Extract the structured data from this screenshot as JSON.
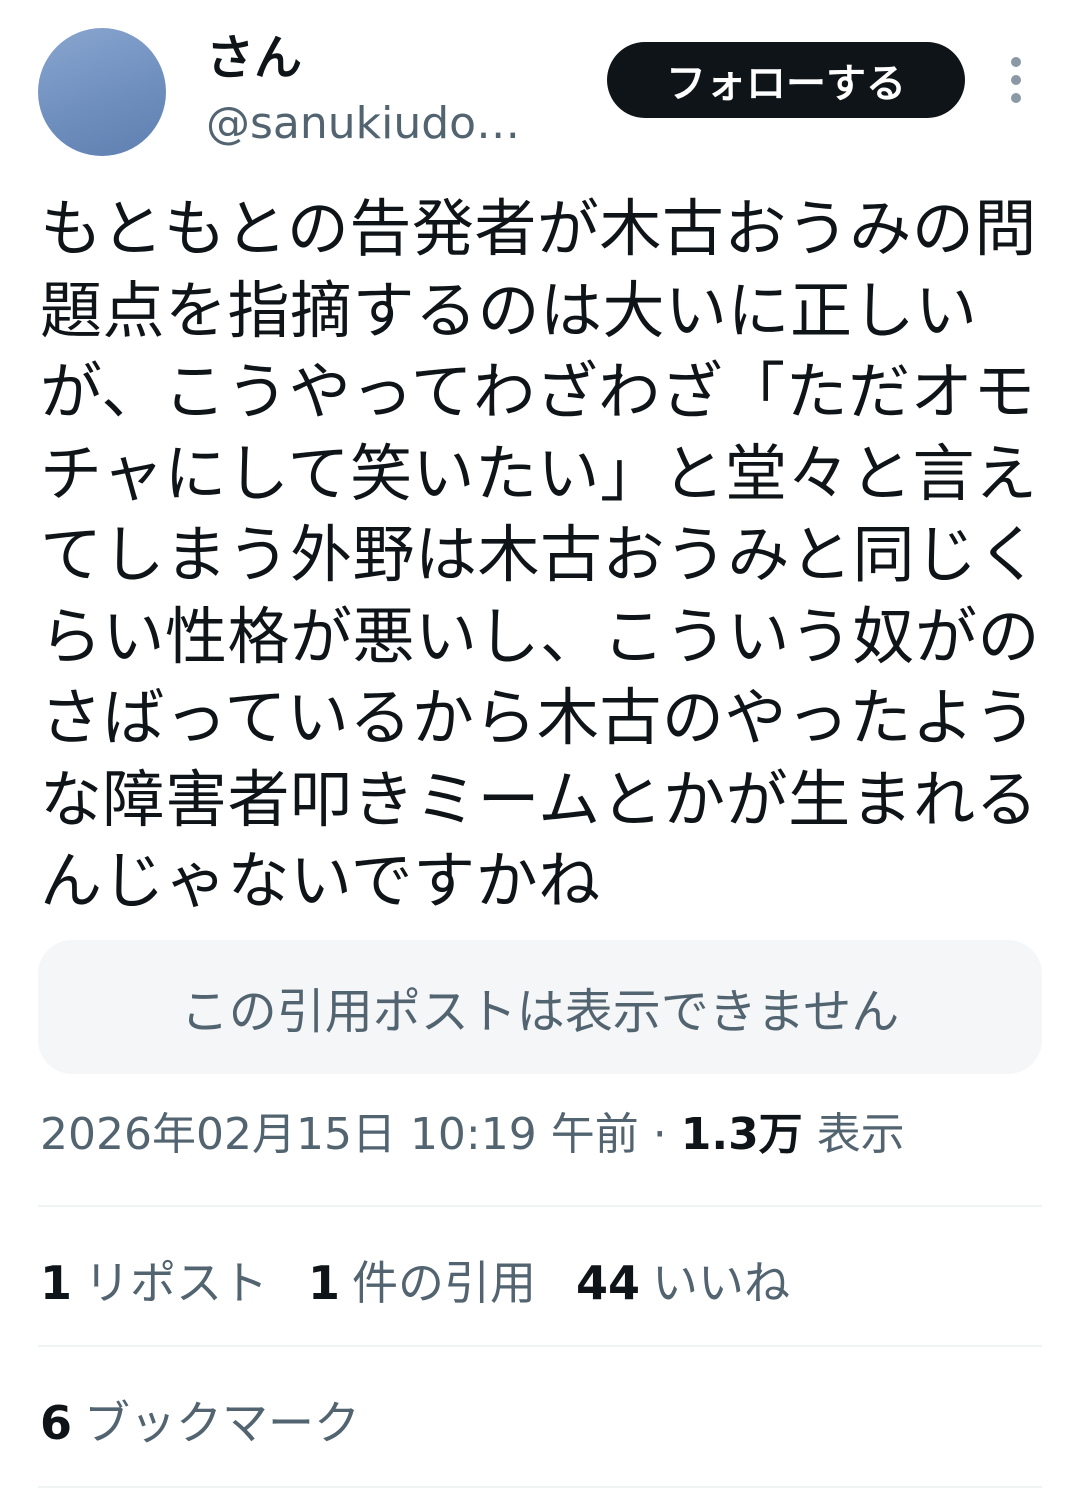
{
  "author": {
    "display_name": "さん",
    "handle": "@sanukiudo…",
    "avatar_color": "#7191c0"
  },
  "header": {
    "follow_label": "フォローする",
    "more_icon": "more-vertical-icon"
  },
  "tweet": {
    "text": "もともとの告発者が木古おうみの問題点を指摘するのは大いに正しいが、こうやってわざわざ「ただオモチャにして笑いたい」と堂々と言えてしまう外野は木古おうみと同じくらい性格が悪いし、こういう奴がのさばっているから木古のやったような障害者叩きミームとかが生まれるんじゃないですかね"
  },
  "quote": {
    "unavailable_text": "この引用ポストは表示できません"
  },
  "meta": {
    "timestamp": "2026年02月15日 10:19 午前",
    "separator": "·",
    "views_count": "1.3万",
    "views_label": "表示"
  },
  "stats": {
    "reposts": {
      "count": "1",
      "label": "リポスト"
    },
    "quotes": {
      "count": "1",
      "label": "件の引用"
    },
    "likes": {
      "count": "44",
      "label": "いいね"
    },
    "bookmarks": {
      "count": "6",
      "label": "ブックマーク"
    }
  },
  "colors": {
    "text_primary": "#0f1419",
    "text_secondary": "#536471",
    "button_bg": "#0f1419",
    "quote_bg": "#f4f6f8",
    "divider": "#eff3f4"
  }
}
